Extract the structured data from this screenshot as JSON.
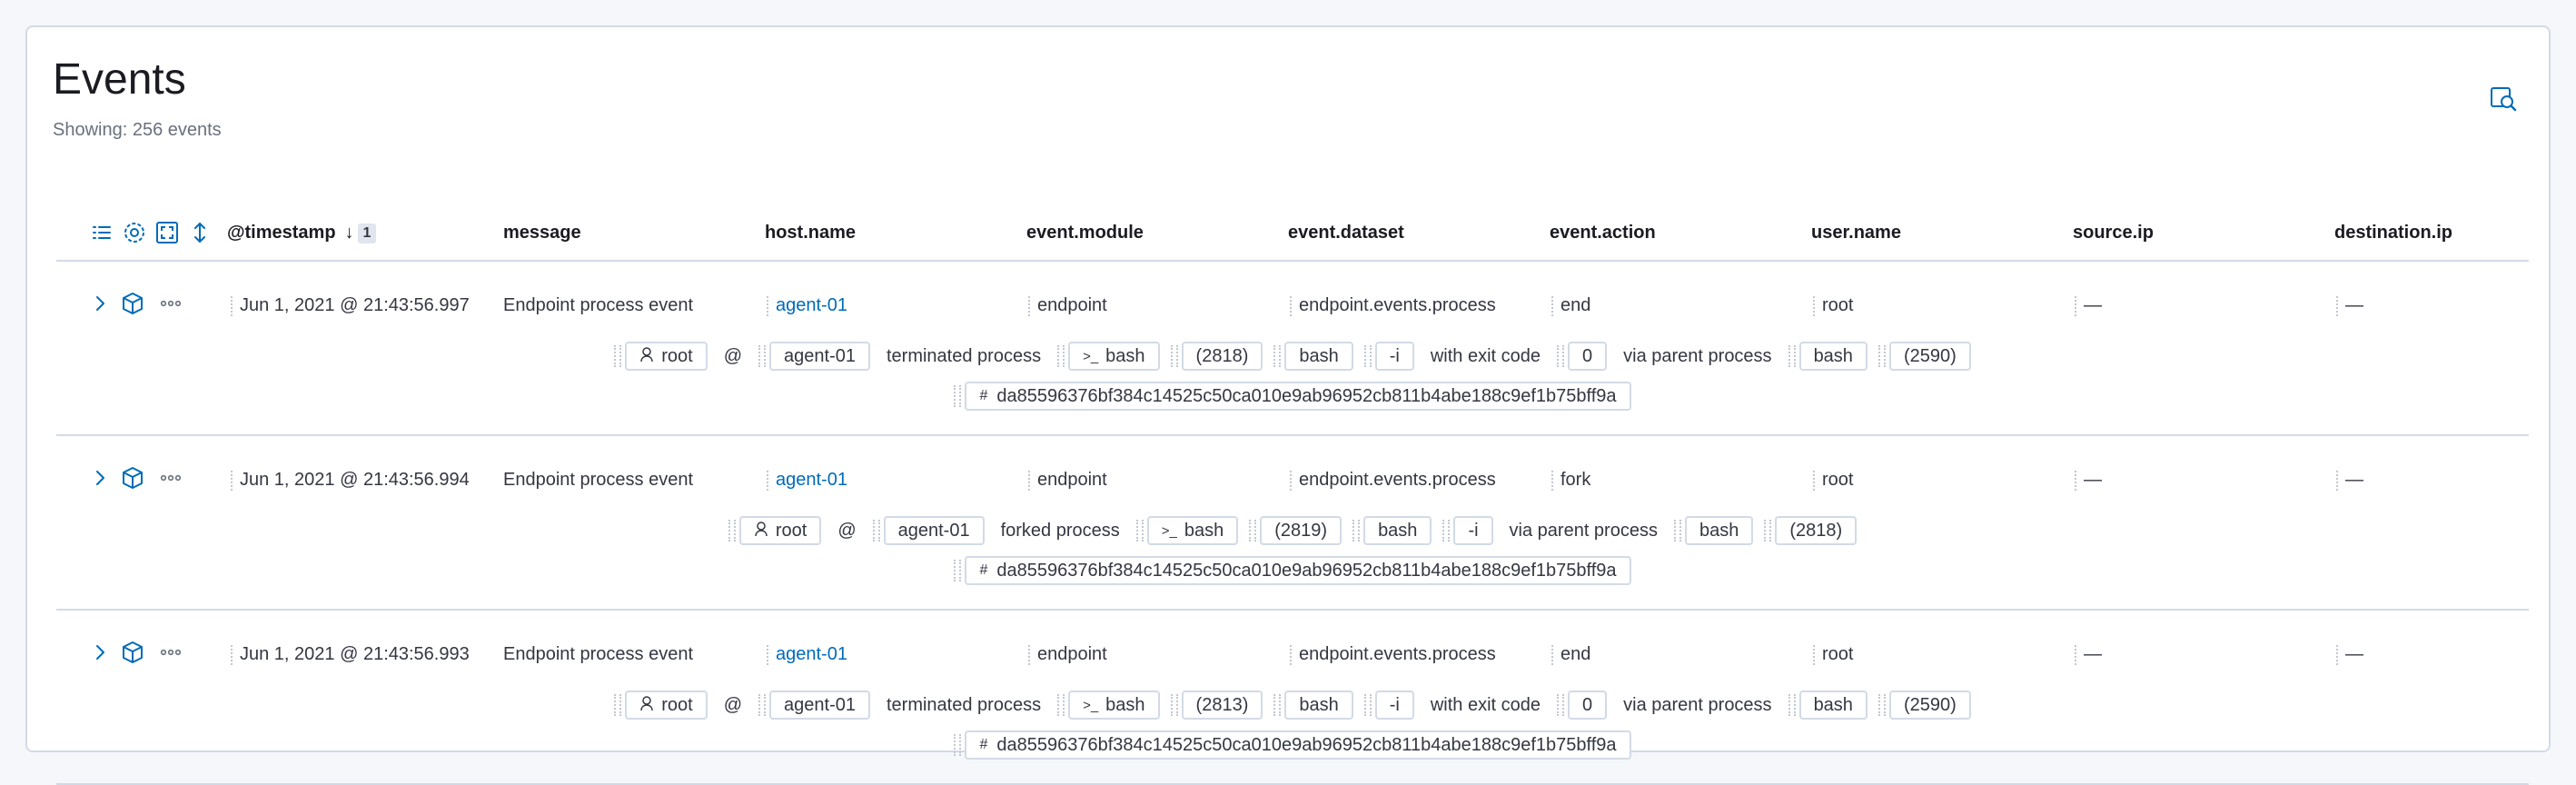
{
  "page": {
    "title": "Events",
    "subtitle": "Showing: 256 events"
  },
  "toolbar": {
    "inspect_icon": "inspect-icon"
  },
  "columns": {
    "timestamp": "@timestamp",
    "sort_count": "1",
    "message": "message",
    "host": "host.name",
    "module": "event.module",
    "dataset": "event.dataset",
    "action": "event.action",
    "user": "user.name",
    "source_ip": "source.ip",
    "destination_ip": "destination.ip"
  },
  "header_icons": [
    "list-icon",
    "gear-icon",
    "fullscreen-icon",
    "sort-icon"
  ],
  "labels": {
    "at": "@",
    "with_exit_code": "with exit code",
    "via_parent": "via parent process",
    "hash_symbol": "#",
    "terminal_symbol": ">_"
  },
  "events": [
    {
      "timestamp": "Jun 1, 2021 @ 21:43:56.997",
      "message": "Endpoint process event",
      "host": "agent-01",
      "module": "endpoint",
      "dataset": "endpoint.events.process",
      "action": "end",
      "user": "root",
      "source_ip": "—",
      "destination_ip": "—",
      "summary": {
        "user": "root",
        "host": "agent-01",
        "verb": "terminated process",
        "process": "bash",
        "pid": "(2818)",
        "args": [
          "bash",
          "-i"
        ],
        "exit_code": "0",
        "parent": "bash",
        "parent_pid": "(2590)",
        "hash": "da85596376bf384c14525c50ca010e9ab96952cb811b4abe188c9ef1b75bff9a"
      }
    },
    {
      "timestamp": "Jun 1, 2021 @ 21:43:56.994",
      "message": "Endpoint process event",
      "host": "agent-01",
      "module": "endpoint",
      "dataset": "endpoint.events.process",
      "action": "fork",
      "user": "root",
      "source_ip": "—",
      "destination_ip": "—",
      "summary": {
        "user": "root",
        "host": "agent-01",
        "verb": "forked process",
        "process": "bash",
        "pid": "(2819)",
        "args": [
          "bash",
          "-i"
        ],
        "parent": "bash",
        "parent_pid": "(2818)",
        "hash": "da85596376bf384c14525c50ca010e9ab96952cb811b4abe188c9ef1b75bff9a"
      }
    },
    {
      "timestamp": "Jun 1, 2021 @ 21:43:56.993",
      "message": "Endpoint process event",
      "host": "agent-01",
      "module": "endpoint",
      "dataset": "endpoint.events.process",
      "action": "end",
      "user": "root",
      "source_ip": "—",
      "destination_ip": "—",
      "summary": {
        "user": "root",
        "host": "agent-01",
        "verb": "terminated process",
        "process": "bash",
        "pid": "(2813)",
        "args": [
          "bash",
          "-i"
        ],
        "exit_code": "0",
        "parent": "bash",
        "parent_pid": "(2590)",
        "hash": "da85596376bf384c14525c50ca010e9ab96952cb811b4abe188c9ef1b75bff9a"
      }
    }
  ],
  "colors": {
    "link": "#006bb8",
    "border": "#d3dae6",
    "text": "#343741"
  }
}
